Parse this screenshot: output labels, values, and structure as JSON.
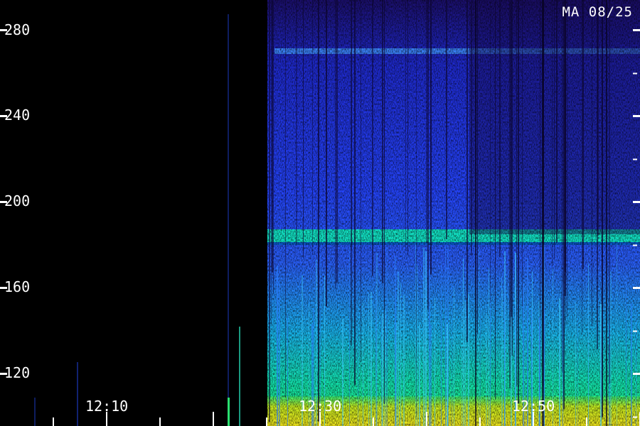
{
  "station_stamp": "MA 08/25",
  "y_axis": {
    "ticks": [
      {
        "value": 280,
        "label": "280"
      },
      {
        "value": 240,
        "label": "240"
      },
      {
        "value": 200,
        "label": "200"
      },
      {
        "value": 160,
        "label": "160"
      },
      {
        "value": 120,
        "label": "120"
      }
    ]
  },
  "x_axis": {
    "ticks": [
      {
        "label": "12:10"
      },
      {
        "label": "12:30"
      },
      {
        "label": "12:50"
      }
    ]
  },
  "colors": {
    "background": "#000000",
    "low": "#1a0a5a",
    "mid": "#1e3cff",
    "band": "#12e6c8",
    "high": "#f2f21a",
    "axis": "#ffffff"
  }
}
